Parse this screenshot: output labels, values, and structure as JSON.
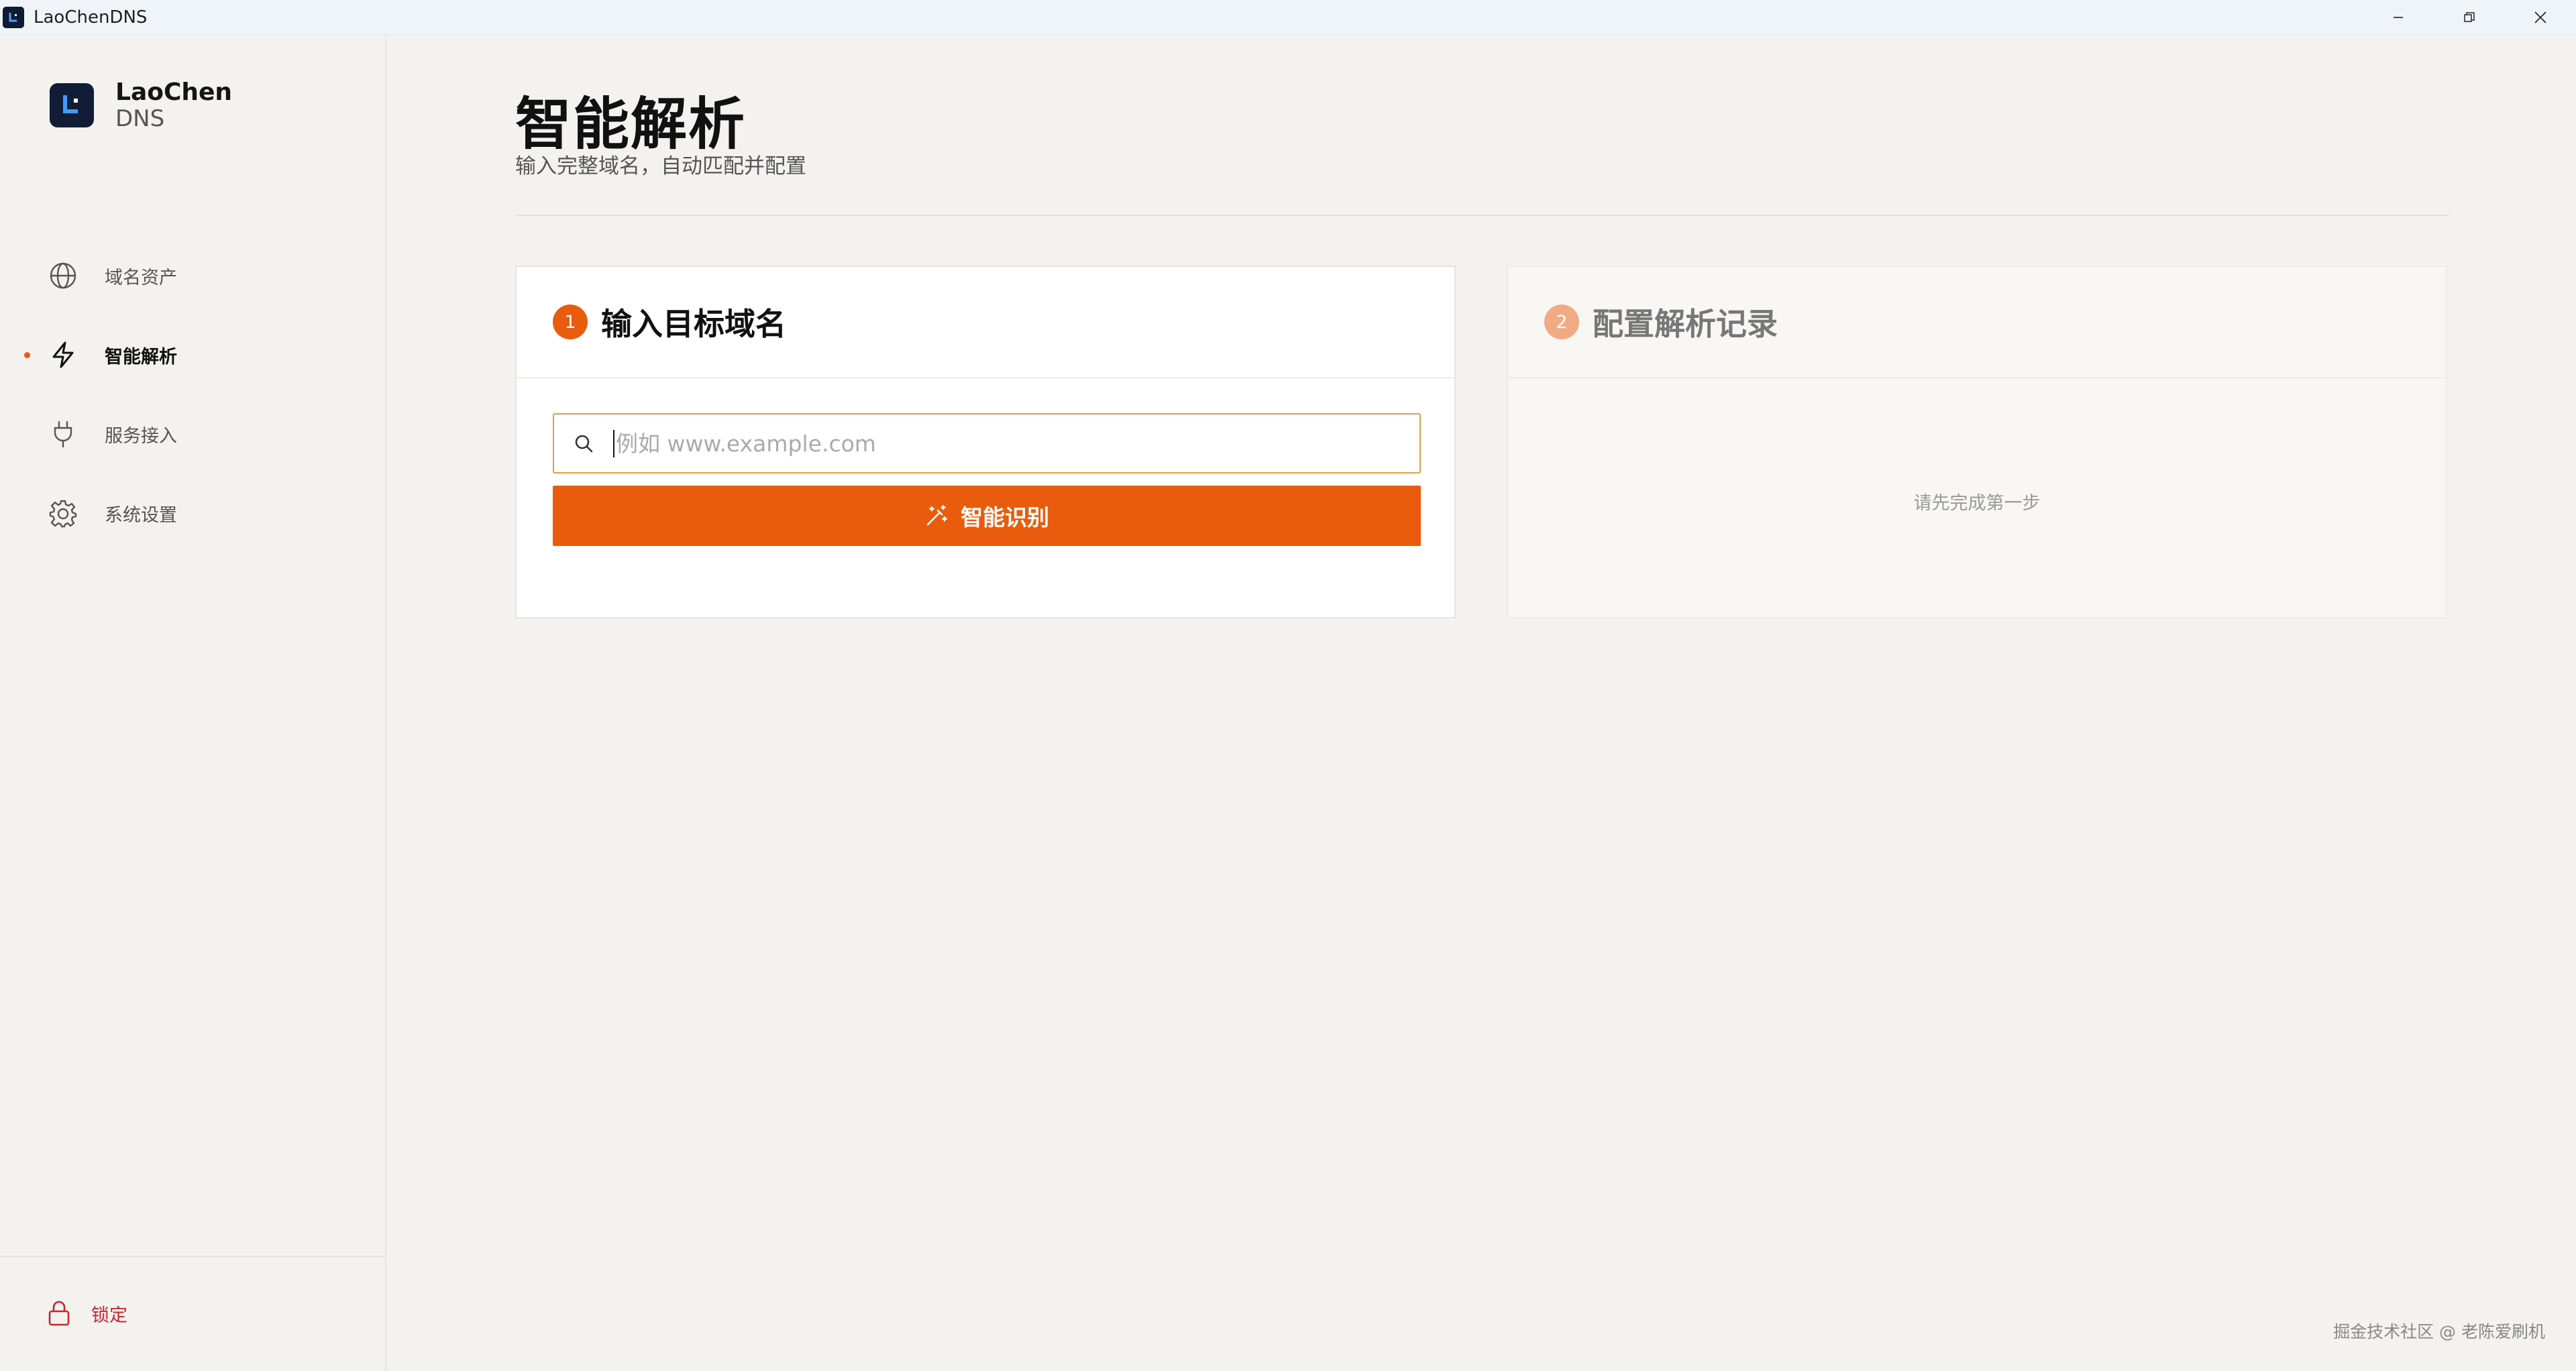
{
  "window": {
    "title": "LaoChenDNS",
    "controls": [
      "minimize",
      "restore",
      "close"
    ]
  },
  "brand": {
    "name": "LaoChen",
    "sub": "DNS"
  },
  "nav": {
    "items": [
      {
        "label": "域名资产",
        "icon": "globe-icon",
        "active": false
      },
      {
        "label": "智能解析",
        "icon": "lightning-icon",
        "active": true
      },
      {
        "label": "服务接入",
        "icon": "plug-icon",
        "active": false
      },
      {
        "label": "系统设置",
        "icon": "gear-icon",
        "active": false
      }
    ]
  },
  "footer": {
    "lock_label": "锁定"
  },
  "page": {
    "title": "智能解析",
    "subtitle": "输入完整域名，自动匹配并配置"
  },
  "step1": {
    "number": "1",
    "title": "输入目标域名",
    "input_value": "",
    "input_placeholder": "例如 www.example.com",
    "button_label": "智能识别"
  },
  "step2": {
    "number": "2",
    "title": "配置解析记录",
    "empty_hint": "请先完成第一步"
  },
  "watermark": "掘金技术社区 @ 老陈爱刷机",
  "colors": {
    "accent": "#e95c0d",
    "accent_muted": "#f1ab83",
    "danger": "#c6262e",
    "background": "#f3f2ee",
    "titlebar": "#eff4f9",
    "brand_dark": "#111d36"
  }
}
